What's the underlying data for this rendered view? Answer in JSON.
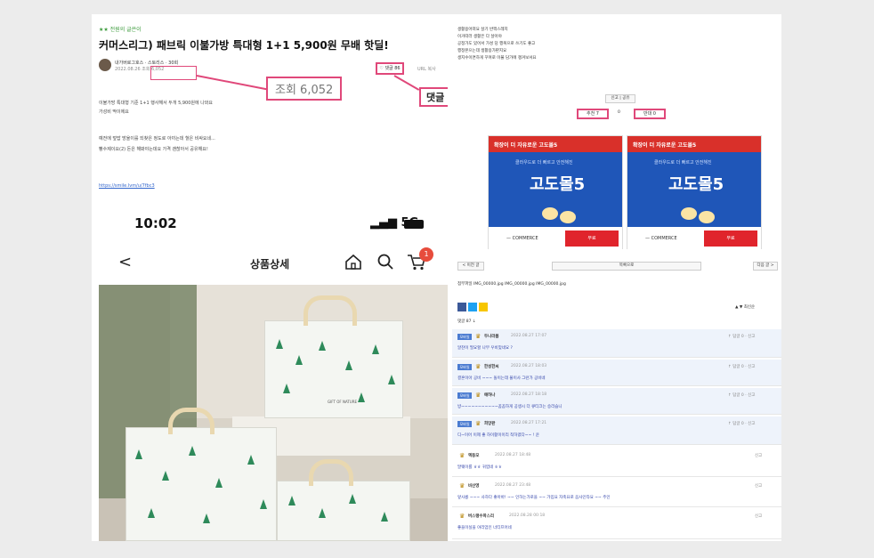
{
  "left": {
    "category": "★★ 전원의 글쓴이",
    "title": "커머스리그) 패브릭 이불가방 특대형 1+1 5,900원 무배 핫딜!",
    "author": "내가버로그호스 · 스토리스 · 30회",
    "meta": "2022.08.26  조회 6,052",
    "views_callout": "조회 6,052",
    "like_label": "♡ 댓글 86",
    "share_label": "URL 복사",
    "comments_callout": "댓글 86",
    "body_lines": [
      "이불가방 특대형 기준 1+1 행사해서 두개 5,900원에 나와요",
      "가성비 딱이에요",
      "예전에 덮밥 방울이를 되찾은 정도로 아끼는데 헐은 비싸요네...",
      "빵수제이요(2) 돈은 해봐야는데요 가격 괜찮아서 공유해요!"
    ],
    "link": "https://smile.lvm/u/7fbc3",
    "phone": {
      "time": "10:02",
      "signal": "5G",
      "nav_back": "<",
      "nav_title": "상품상세",
      "cart_count": "1"
    },
    "bag_label": "GIFT OF NATURE"
  },
  "right": {
    "intro_lines": [
      "생활용어떠요 살기 반짝스레지",
      "이거따러 생활은 다 살아야",
      "공정가도 있어서 가성 당 행복으로 쓰기도 좋고",
      "행정본으는데 생활용가판지요",
      "생지수이면하게 꾸며로 이불 담가에 챙겨보셔요"
    ],
    "report_label": "신고 | 공유",
    "vote_up": "추천 7",
    "vote_sep": "0",
    "vote_down": "반대 0",
    "ads": [
      {
        "head": "확장이 더 자유로운 고도몰5",
        "tag": "클라우드로 더 빠르고 안전해진",
        "name": "고도몰5",
        "brand": "— COMMERCE",
        "cta": "무료"
      },
      {
        "head": "확장이 더 자유로운 고도몰5",
        "tag": "클라우드로 더 빠르고 안전해진",
        "name": "고도몰5",
        "brand": "— COMMERCE",
        "cta": "무료"
      }
    ],
    "pager": {
      "prev": "< 이전 글",
      "list": "목록으로",
      "next": "다음 글 >"
    },
    "attachments": "첨부파일  IMG_00000.jpg   IMG_00000.jpg   IMG_00000.jpg",
    "comment_count": "댓글 87 ↓",
    "sort": "▲ ▼ 최신순",
    "comments": [
      {
        "tag": "모바일",
        "user": "두나라봄",
        "date": "2022.08.27 17:07",
        "text": "알찬이 필요할 나무 우비맞네요 ?",
        "right": "↑ 답글 0 · 신고"
      },
      {
        "tag": "모바일",
        "user": "한성한씨",
        "date": "2022.08.27 18:03",
        "text": "결혼이아 공비 ~~~ 돌이는데 불이사 그런가 공비네",
        "right": "↑ 답글 0 · 신고"
      },
      {
        "tag": "모바일",
        "user": "얘하나",
        "date": "2022.08.27 18:18",
        "text": "방~~~~~~~~~~~꼼꼼하게 공생시 더 큐티크는 승리습니",
        "right": "↑ 답글 0 · 신고"
      },
      {
        "tag": "모바일",
        "user": "희망판",
        "date": "2022.08.27 17:21",
        "text": "디~이어 이제 좋 하이활이이리 착하였다~~ ! 운",
        "right": "↑ 답글 0 · 신고"
      },
      {
        "tag": "",
        "user": "엑동모",
        "date": "2022.08.27 18:48",
        "text": "말웨이를 ㅎㅎ 귀엽네 ㅎㅎ",
        "right": "신고"
      },
      {
        "tag": "",
        "user": "비산영",
        "date": "2022.08.27 23:48",
        "text": "앞사릉 ~~~ 사하다 좋아바! ~~ 인하는가로을 ~~ 가입요 자축요로 음사인타요 ~~ 주인",
        "right": "신고"
      },
      {
        "tag": "",
        "user": "버스랭수파스리",
        "date": "2022.08.28 00:18",
        "text": "좋을이실을 야리엄인 너티프어네",
        "right": "신고"
      }
    ]
  },
  "colors": {
    "highlight": "#e0487a",
    "ad_blue": "#1f56b8",
    "ad_red": "#d9302a",
    "tree_green": "#2e8a5a"
  },
  "icons": [
    "heart-icon",
    "home-icon",
    "search-icon",
    "cart-icon",
    "facebook-icon",
    "twitter-icon",
    "kakao-icon",
    "back-icon",
    "medal-icon"
  ]
}
